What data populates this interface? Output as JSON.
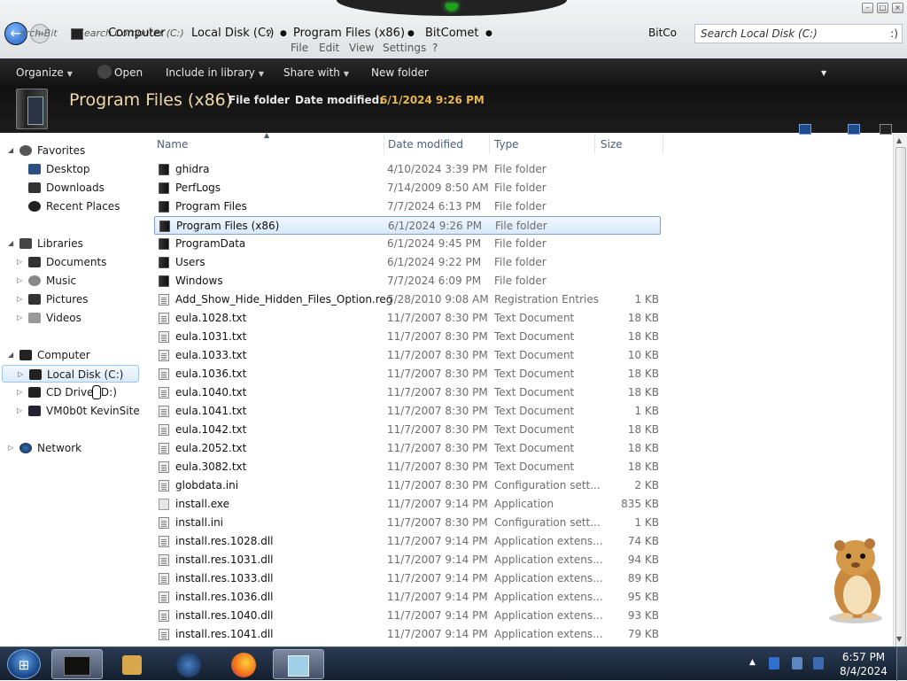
{
  "window": {
    "nav_history": [
      "arch Bit",
      "Search Computer (C:)",
      "Computer"
    ],
    "breadcrumb": [
      "Local Disk (C:)",
      "Program Files (x86)",
      "BitComet"
    ],
    "search_overlap": "BitCo",
    "search_placeholder": "Search Local Disk (C:)",
    "search_suffix": ":)"
  },
  "menubar": [
    "File",
    "Edit",
    "View",
    "Settings",
    "?"
  ],
  "toolbar": {
    "organize": "Organize",
    "open": "Open",
    "include": "Include in library",
    "share": "Share with",
    "new_folder": "New folder"
  },
  "details": {
    "name": "Program Files (x86)",
    "type": "File folder",
    "modified_label": "Date modified:",
    "modified_value": "6/1/2024 9:26 PM"
  },
  "nav": {
    "favorites": "Favorites",
    "desktop": "Desktop",
    "downloads": "Downloads",
    "recent": "Recent Places",
    "libraries": "Libraries",
    "documents": "Documents",
    "music": "Music",
    "pictures": "Pictures",
    "videos": "Videos",
    "computer": "Computer",
    "local_disk": "Local Disk (C:)",
    "cd_drive": "CD Drive (D:)",
    "vm_share": "VM0b0t KevinSite",
    "network": "Network"
  },
  "columns": {
    "name": "Name",
    "date": "Date modified",
    "type": "Type",
    "size": "Size"
  },
  "files": [
    {
      "name": "ghidra",
      "date": "4/10/2024 3:39 PM",
      "type": "File folder",
      "size": "",
      "icon": "folder"
    },
    {
      "name": "PerfLogs",
      "date": "7/14/2009 8:50 AM",
      "type": "File folder",
      "size": "",
      "icon": "folder"
    },
    {
      "name": "Program Files",
      "date": "7/7/2024 6:13 PM",
      "type": "File folder",
      "size": "",
      "icon": "folder"
    },
    {
      "name": "Program Files (x86)",
      "date": "6/1/2024 9:26 PM",
      "type": "File folder",
      "size": "",
      "icon": "folder",
      "selected": true
    },
    {
      "name": "ProgramData",
      "date": "6/1/2024 9:45 PM",
      "type": "File folder",
      "size": "",
      "icon": "folder"
    },
    {
      "name": "Users",
      "date": "6/1/2024 9:22 PM",
      "type": "File folder",
      "size": "",
      "icon": "folder"
    },
    {
      "name": "Windows",
      "date": "7/7/2024 6:09 PM",
      "type": "File folder",
      "size": "",
      "icon": "folder"
    },
    {
      "name": "Add_Show_Hide_Hidden_Files_Option.reg",
      "date": "5/28/2010 9:08 AM",
      "type": "Registration Entries",
      "size": "1 KB",
      "icon": "doc"
    },
    {
      "name": "eula.1028.txt",
      "date": "11/7/2007 8:30 PM",
      "type": "Text Document",
      "size": "18 KB",
      "icon": "doc"
    },
    {
      "name": "eula.1031.txt",
      "date": "11/7/2007 8:30 PM",
      "type": "Text Document",
      "size": "18 KB",
      "icon": "doc"
    },
    {
      "name": "eula.1033.txt",
      "date": "11/7/2007 8:30 PM",
      "type": "Text Document",
      "size": "10 KB",
      "icon": "doc"
    },
    {
      "name": "eula.1036.txt",
      "date": "11/7/2007 8:30 PM",
      "type": "Text Document",
      "size": "18 KB",
      "icon": "doc"
    },
    {
      "name": "eula.1040.txt",
      "date": "11/7/2007 8:30 PM",
      "type": "Text Document",
      "size": "18 KB",
      "icon": "doc"
    },
    {
      "name": "eula.1041.txt",
      "date": "11/7/2007 8:30 PM",
      "type": "Text Document",
      "size": "1 KB",
      "icon": "doc"
    },
    {
      "name": "eula.1042.txt",
      "date": "11/7/2007 8:30 PM",
      "type": "Text Document",
      "size": "18 KB",
      "icon": "doc"
    },
    {
      "name": "eula.2052.txt",
      "date": "11/7/2007 8:30 PM",
      "type": "Text Document",
      "size": "18 KB",
      "icon": "doc"
    },
    {
      "name": "eula.3082.txt",
      "date": "11/7/2007 8:30 PM",
      "type": "Text Document",
      "size": "18 KB",
      "icon": "doc"
    },
    {
      "name": "globdata.ini",
      "date": "11/7/2007 8:30 PM",
      "type": "Configuration sett...",
      "size": "2 KB",
      "icon": "doc"
    },
    {
      "name": "install.exe",
      "date": "11/7/2007 9:14 PM",
      "type": "Application",
      "size": "835 KB",
      "icon": "app"
    },
    {
      "name": "install.ini",
      "date": "11/7/2007 8:30 PM",
      "type": "Configuration sett...",
      "size": "1 KB",
      "icon": "doc"
    },
    {
      "name": "install.res.1028.dll",
      "date": "11/7/2007 9:14 PM",
      "type": "Application extens...",
      "size": "74 KB",
      "icon": "doc"
    },
    {
      "name": "install.res.1031.dll",
      "date": "11/7/2007 9:14 PM",
      "type": "Application extens...",
      "size": "94 KB",
      "icon": "doc"
    },
    {
      "name": "install.res.1033.dll",
      "date": "11/7/2007 9:14 PM",
      "type": "Application extens...",
      "size": "89 KB",
      "icon": "doc"
    },
    {
      "name": "install.res.1036.dll",
      "date": "11/7/2007 9:14 PM",
      "type": "Application extens...",
      "size": "95 KB",
      "icon": "doc"
    },
    {
      "name": "install.res.1040.dll",
      "date": "11/7/2007 9:14 PM",
      "type": "Application extens...",
      "size": "93 KB",
      "icon": "doc"
    },
    {
      "name": "install.res.1041.dll",
      "date": "11/7/2007 9:14 PM",
      "type": "Application extens...",
      "size": "79 KB",
      "icon": "doc"
    }
  ],
  "taskbar": {
    "time": "6:57 PM",
    "date": "8/4/2024"
  },
  "colors": {
    "accent": "#f0d9a8",
    "date_accent": "#e8b64a",
    "selection": "#d8e9fc",
    "toolbar_bg": "#1a1a1a"
  }
}
